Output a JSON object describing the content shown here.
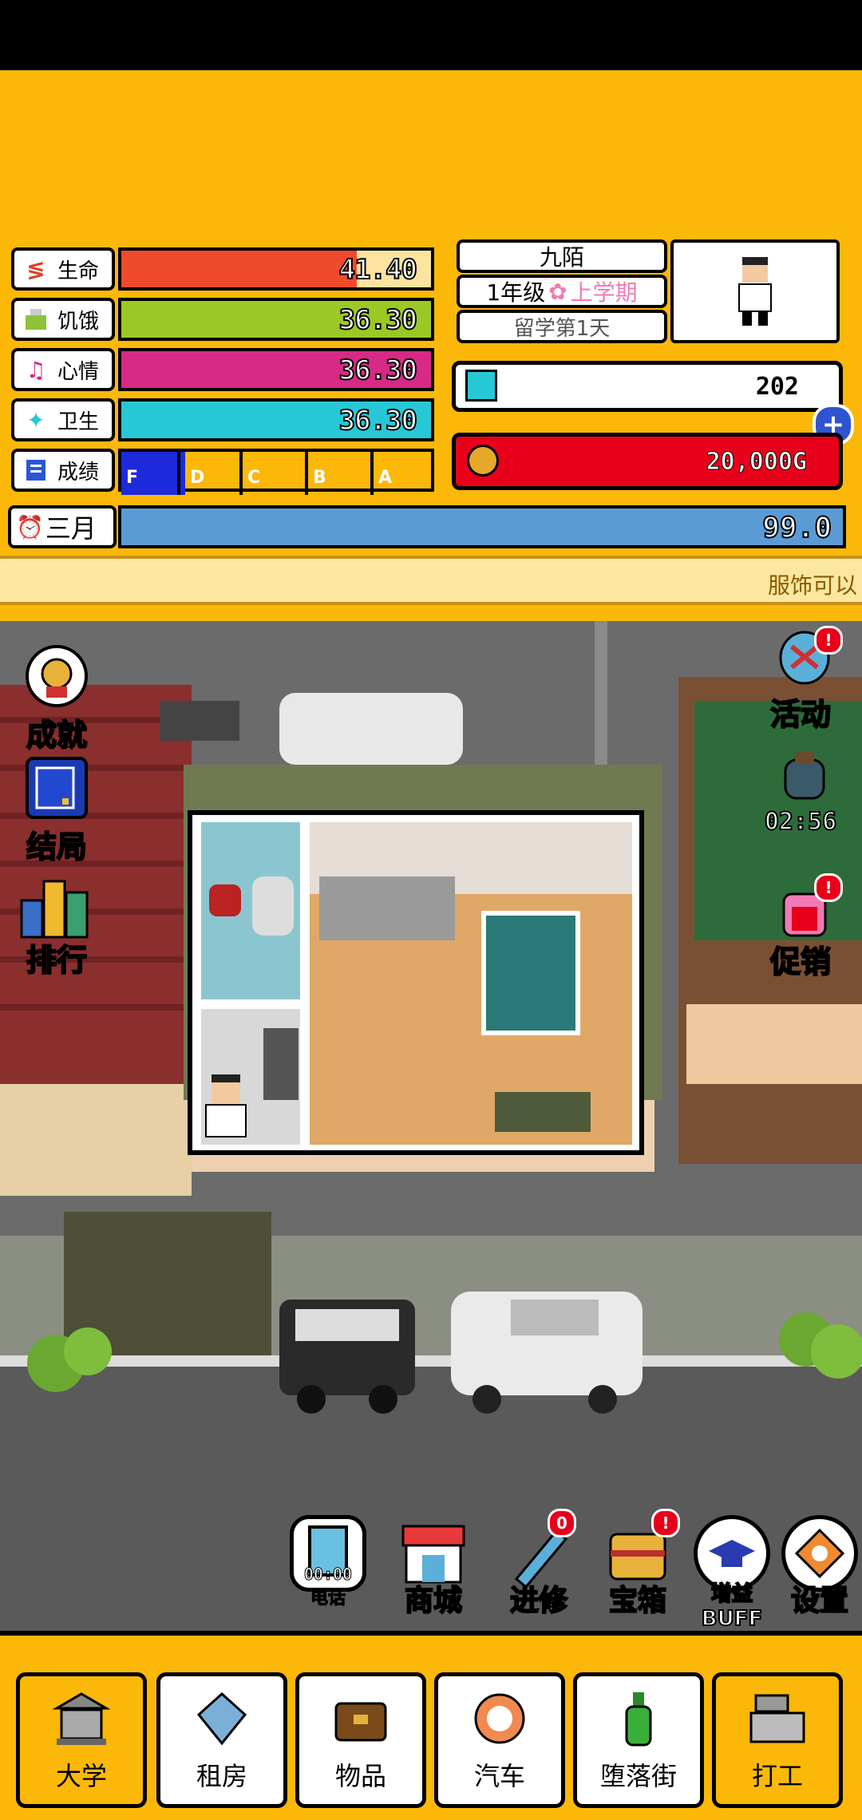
{
  "stats": [
    {
      "label": "生命",
      "value": "41.40",
      "fill": 0.76,
      "color": "#f04a2c",
      "icon": "heart-bolt-icon"
    },
    {
      "label": "饥饿",
      "value": "36.30",
      "fill": 1.0,
      "color": "#9cc826",
      "icon": "bowl-icon"
    },
    {
      "label": "心情",
      "value": "36.30",
      "fill": 1.0,
      "color": "#d62a86",
      "icon": "music-note-icon"
    },
    {
      "label": "卫生",
      "value": "36.30",
      "fill": 1.0,
      "color": "#27c8d6",
      "icon": "droplet-icon"
    }
  ],
  "grades": {
    "label": "成绩",
    "icon": "report-icon",
    "levels": [
      "F",
      "D",
      "C",
      "B",
      "A"
    ]
  },
  "month": {
    "label": "三月",
    "value": "99.0",
    "icon": "alarm-clock-icon"
  },
  "profile": {
    "name": "九陌",
    "grade": "1年级",
    "term": "上学期",
    "study_day": "留学第1天"
  },
  "currency": {
    "gems": "202",
    "gold": "20,000G"
  },
  "ticker": "服饰可以",
  "side_left": [
    {
      "label": "成就",
      "icon": "medal-icon"
    },
    {
      "label": "结局",
      "icon": "book-icon"
    },
    {
      "label": "排行",
      "icon": "ranking-books-icon"
    }
  ],
  "side_right": [
    {
      "label": "活动",
      "icon": "hot-air-balloon-icon"
    },
    {
      "label": "02:56",
      "icon": "gift-sack-icon"
    },
    {
      "label": "促销",
      "icon": "promo-stall-icon"
    }
  ],
  "dock": [
    {
      "label": "电话",
      "sub": "00:00",
      "icon": "phone-icon"
    },
    {
      "label": "商城",
      "icon": "shop-icon"
    },
    {
      "label": "进修",
      "icon": "pencil-icon",
      "badge": "0"
    },
    {
      "label": "宝箱",
      "icon": "treasure-chest-icon",
      "badge": "!"
    },
    {
      "label": "增益BUFF",
      "icon": "grad-cap-icon"
    },
    {
      "label": "设置",
      "icon": "settings-icon"
    }
  ],
  "nav": [
    {
      "label": "大学",
      "icon": "university-icon"
    },
    {
      "label": "租房",
      "icon": "house-icon"
    },
    {
      "label": "物品",
      "icon": "bag-icon"
    },
    {
      "label": "汽车",
      "icon": "car-wheel-icon"
    },
    {
      "label": "堕落街",
      "icon": "bottle-icon"
    },
    {
      "label": "打工",
      "icon": "cash-register-icon"
    }
  ]
}
